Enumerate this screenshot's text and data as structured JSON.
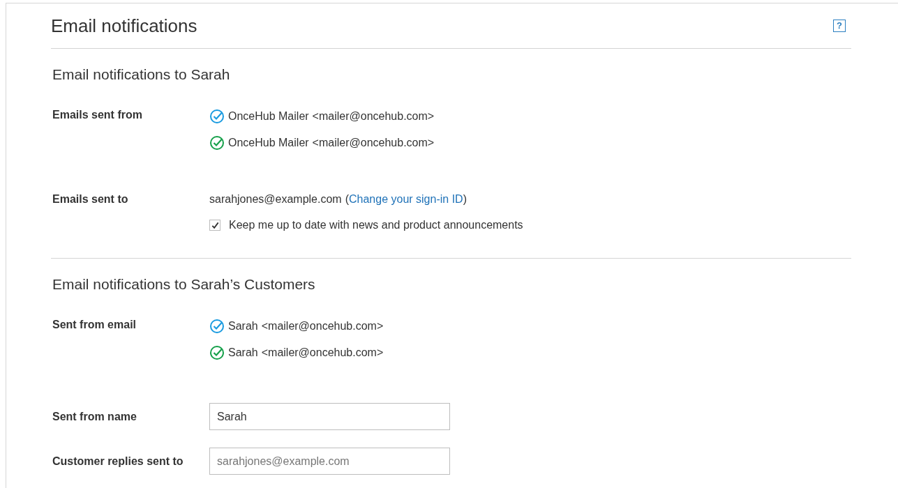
{
  "page": {
    "title": "Email notifications",
    "help": "?"
  },
  "sections": [
    {
      "title": "Email notifications to Sarah",
      "rows": [
        {
          "kind": "senders",
          "label": "Emails sent from",
          "senders": [
            {
              "name": "OnceHub Mailer",
              "address": "<mailer@oncehub.com>",
              "color": "#1a9be0"
            },
            {
              "name": "OnceHub Mailer",
              "address": "<mailer@oncehub.com>",
              "color": "#16a04a"
            }
          ]
        },
        {
          "kind": "recipient",
          "label": "Emails sent to",
          "email": "sarahjones@example.com",
          "paren_open": "(",
          "link": "Change your sign-in ID",
          "paren_close": ")",
          "checkbox": {
            "label": "Keep me up to date with news and product announcements",
            "checked": true
          }
        }
      ]
    },
    {
      "title": "Email notifications to Sarah’s Customers",
      "rows": [
        {
          "kind": "senders",
          "label": "Sent from email",
          "senders": [
            {
              "name": "Sarah",
              "address": "<mailer@oncehub.com>",
              "color": "#1a9be0"
            },
            {
              "name": "Sarah",
              "address": "<mailer@oncehub.com>",
              "color": "#16a04a"
            }
          ]
        },
        {
          "kind": "field",
          "label": "Sent from name",
          "value": "Sarah"
        },
        {
          "kind": "field",
          "label": "Customer replies sent to",
          "placeholder": "sarahjones@example.com"
        }
      ]
    }
  ]
}
